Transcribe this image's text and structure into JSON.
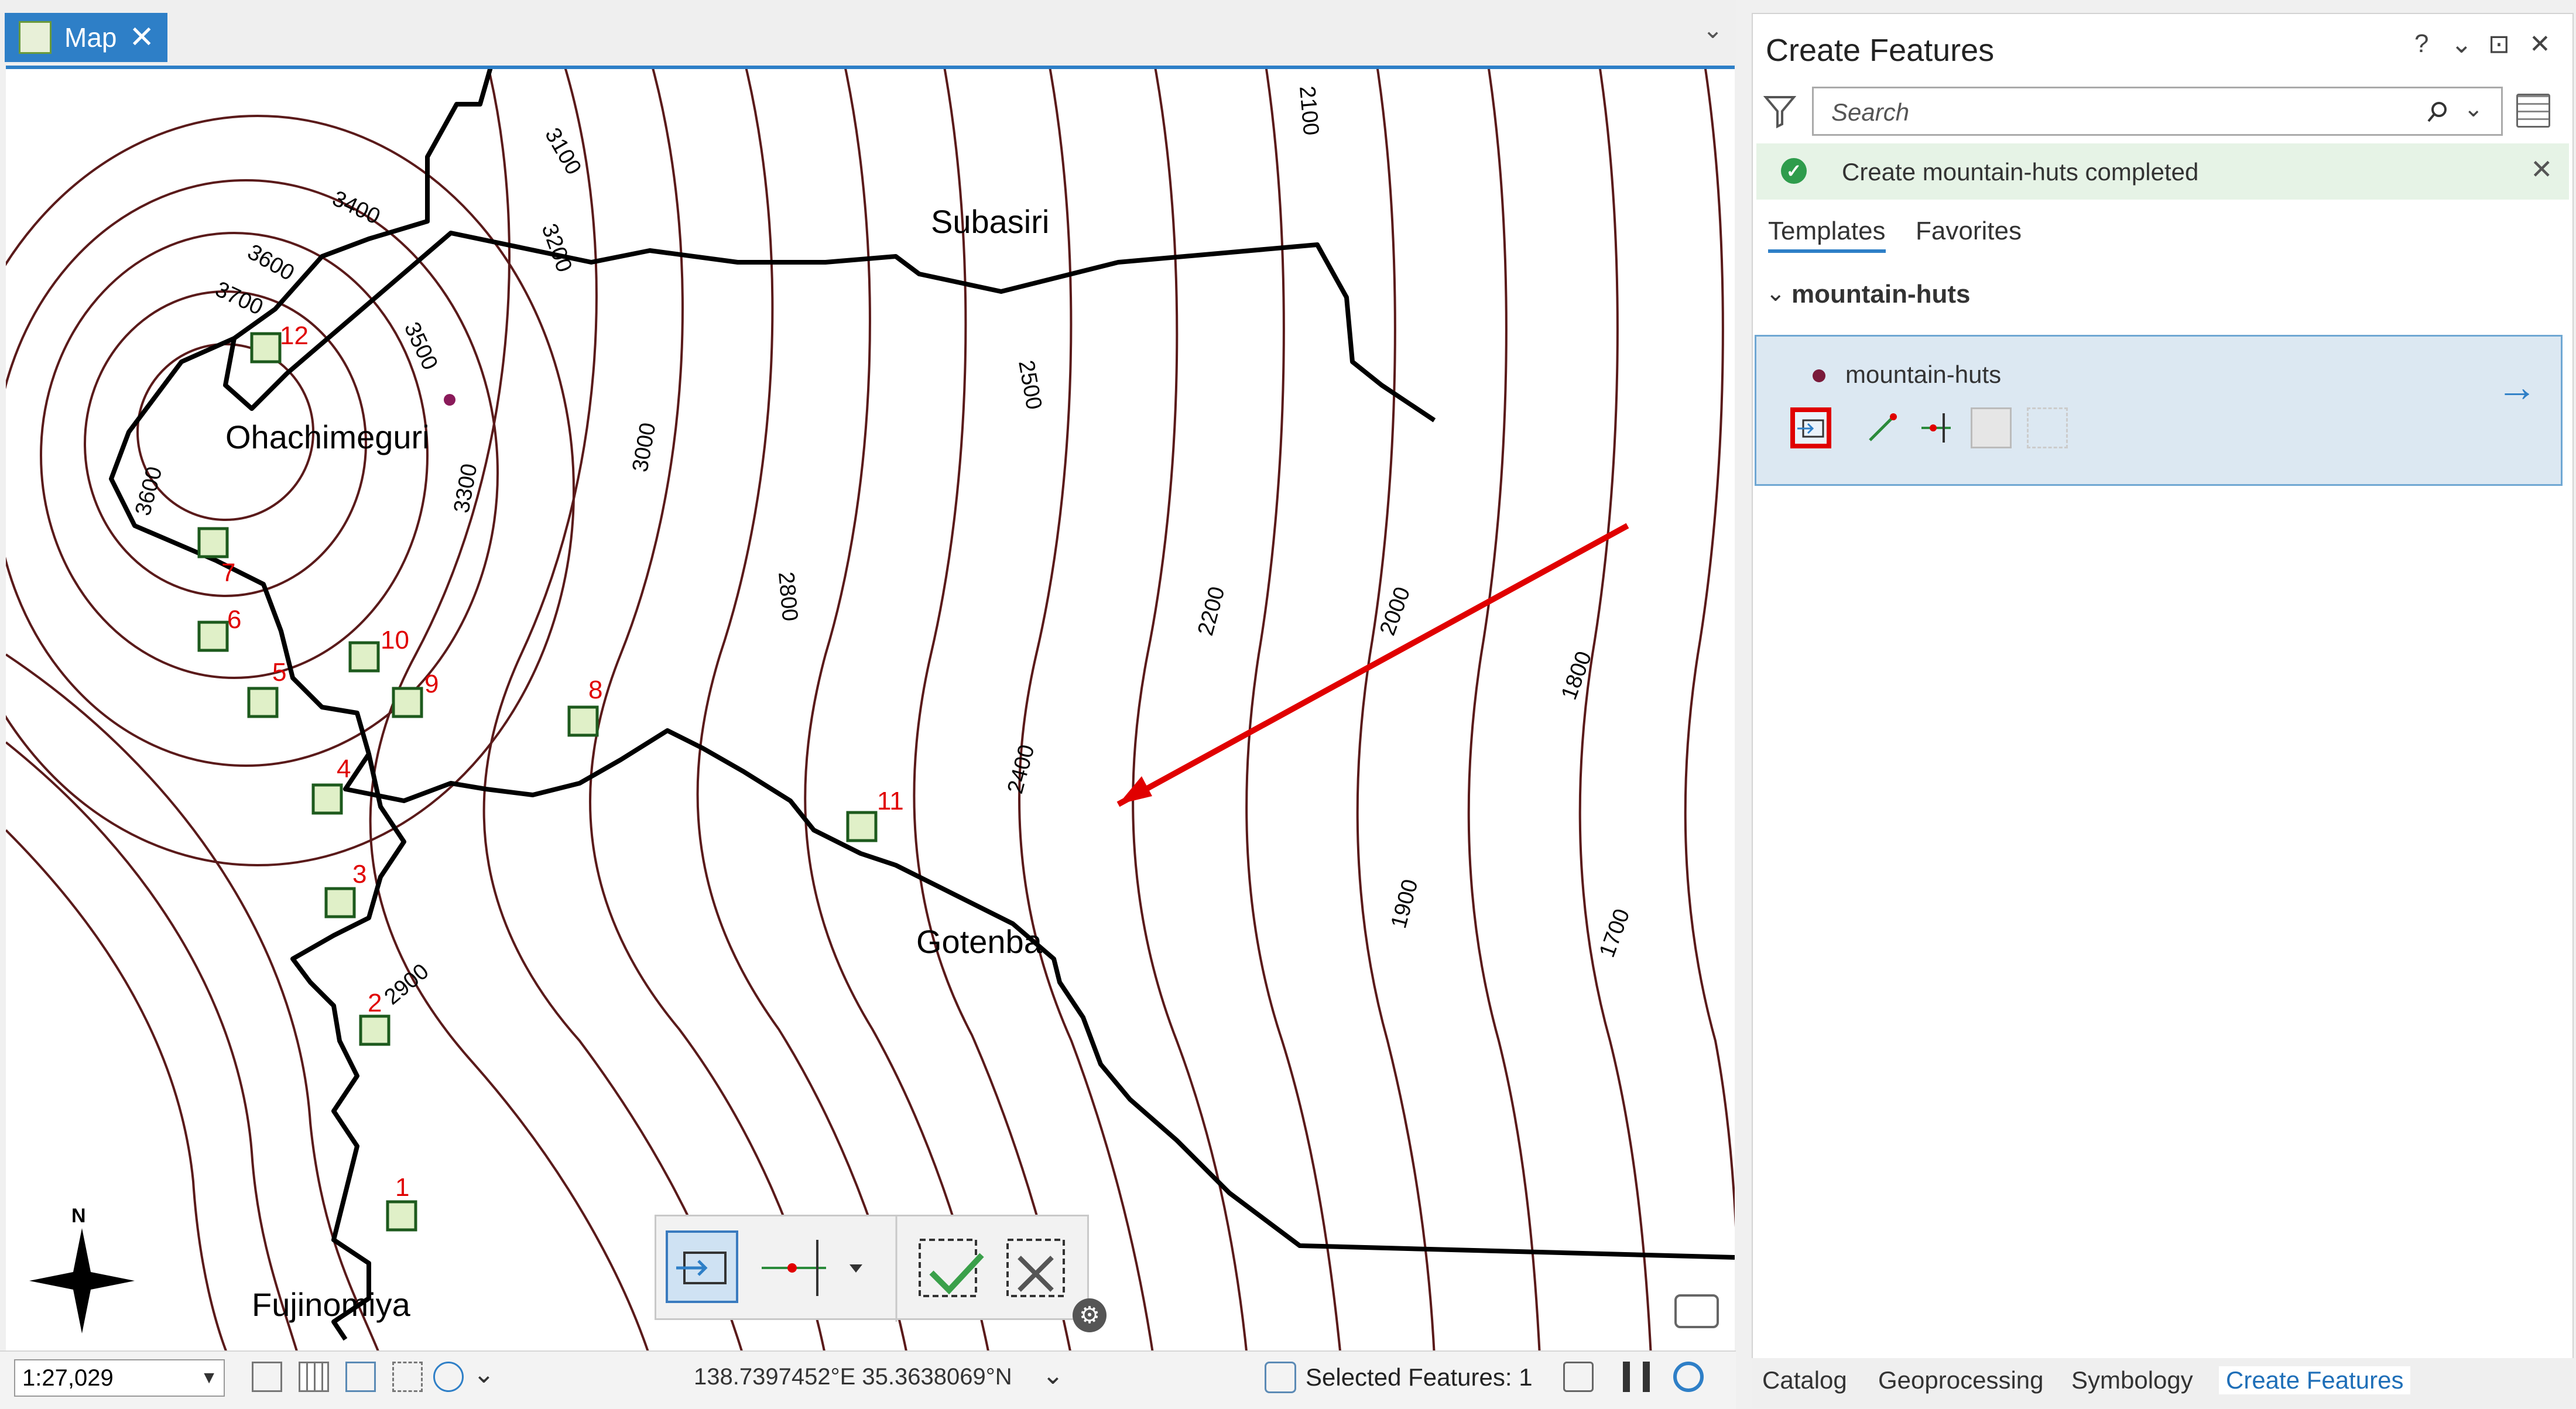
{
  "map_tab": {
    "label": "Map",
    "close": "✕",
    "overflow": "⌄"
  },
  "map": {
    "places": [
      "Subasiri",
      "Ohachimeguri",
      "Gotenba",
      "Fujinomiya"
    ],
    "contour_labels": [
      "3400",
      "3600",
      "3700",
      "3100",
      "3200",
      "3500",
      "3300",
      "3000",
      "2800",
      "2500",
      "2400",
      "2200",
      "2000",
      "2100",
      "1800",
      "1900",
      "1700",
      "2900",
      "3600"
    ],
    "hut_numbers": [
      "12",
      "7",
      "6",
      "5",
      "10",
      "9",
      "8",
      "4",
      "3",
      "11",
      "2",
      "1"
    ],
    "north_letter": "N"
  },
  "statusbar": {
    "scale": "1:27,029",
    "coordinates": "138.7397452°E 35.3638069°N",
    "selected_features": "Selected Features: 1"
  },
  "pane": {
    "title": "Create Features",
    "controls": [
      "?",
      "⌄",
      "⊡",
      "✕"
    ],
    "search_placeholder": "Search",
    "banner_text": "Create mountain-huts completed",
    "tabs": [
      "Templates",
      "Favorites"
    ],
    "group": "mountain-huts",
    "template": {
      "name": "mountain-huts"
    }
  },
  "bottom_tabs": [
    "Catalog",
    "Geoprocessing",
    "Symbology",
    "Create Features"
  ],
  "colors": {
    "accent": "#2e7fc7",
    "contour": "#5a1a1a",
    "highlight": "#e00000",
    "hut_number": "#e00000"
  }
}
